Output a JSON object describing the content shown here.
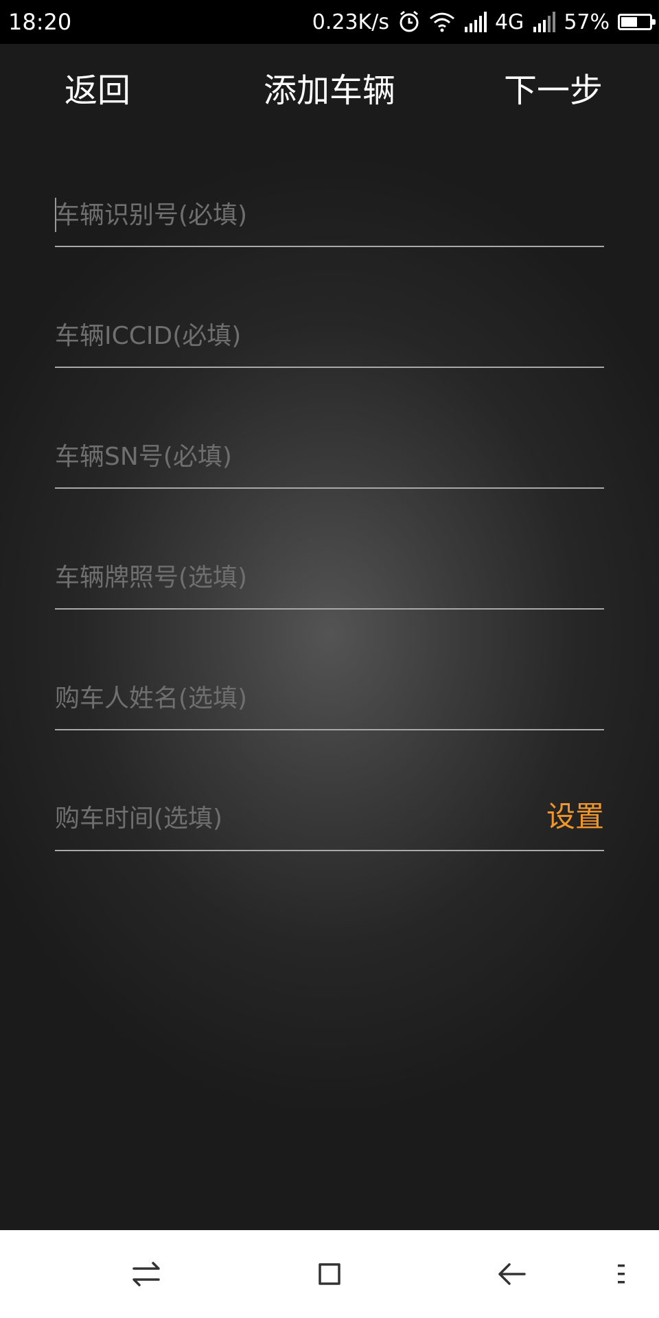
{
  "status_bar": {
    "time": "18:20",
    "network_speed": "0.23K/s",
    "network_type": "4G",
    "battery_percent": "57%",
    "battery_level": 0.57,
    "icons": [
      "alarm-icon",
      "wifi-icon",
      "signal-icon",
      "signal-icon-2",
      "battery-icon"
    ]
  },
  "header": {
    "back_label": "返回",
    "title": "添加车辆",
    "next_label": "下一步"
  },
  "form": {
    "vin_placeholder": "车辆识别号(必填)",
    "iccid_placeholder": "车辆ICCID(必填)",
    "sn_placeholder": "车辆SN号(必填)",
    "plate_placeholder": "车辆牌照号(选填)",
    "buyer_name_placeholder": "购车人姓名(选填)",
    "purchase_time_label": "购车时间(选填)",
    "purchase_time_action": "设置"
  },
  "colors": {
    "accent": "#f0962a",
    "background": "#2a2a2a",
    "divider": "#a9a9a9"
  },
  "system_nav": {
    "icons": [
      "switch-icon",
      "home-icon",
      "back-icon",
      "menu-icon"
    ]
  }
}
